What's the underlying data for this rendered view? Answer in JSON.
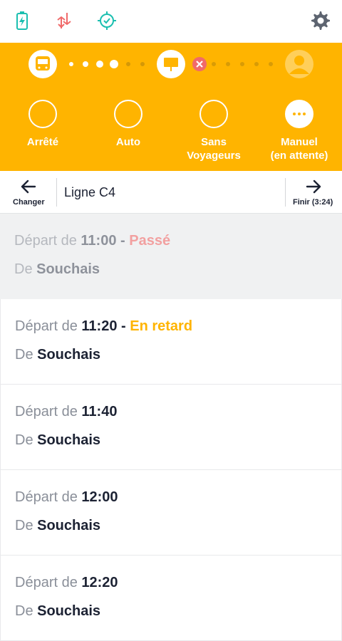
{
  "colors": {
    "accent": "#ffb400",
    "teal": "#1bbfb0",
    "red": "#f06a6a",
    "navy": "#1c2233",
    "past_status": "#f2a0a0",
    "late_status": "#ffb400"
  },
  "topbar": {
    "icons": [
      "battery-charging-icon",
      "data-transfer-icon",
      "gps-target-check-icon",
      "settings-gear-icon"
    ]
  },
  "progress": {
    "start_icon": "bus-icon",
    "middle_icon": "bus-stop-icon",
    "alert_icon": "close-x-icon",
    "end_icon": "user-avatar-icon"
  },
  "modes": [
    {
      "label": "Arrêté",
      "active": false
    },
    {
      "label": "Auto",
      "active": false
    },
    {
      "label": "Sans\nVoyageurs",
      "active": false
    },
    {
      "label": "Manuel\n(en attente)",
      "active": true
    }
  ],
  "nav": {
    "change_label": "Changer",
    "line_name": "Ligne C4",
    "finish_label": "Finir (3:24)"
  },
  "departures": [
    {
      "prefix": "Départ de ",
      "time": "11:00",
      "sep": " - ",
      "status": "Passé",
      "status_kind": "past",
      "from_prefix": "De ",
      "origin": "Souchais"
    },
    {
      "prefix": "Départ de ",
      "time": "11:20",
      "sep": " - ",
      "status": "En retard",
      "status_kind": "late",
      "from_prefix": "De ",
      "origin": "Souchais"
    },
    {
      "prefix": "Départ de ",
      "time": "11:40",
      "sep": "",
      "status": "",
      "status_kind": "",
      "from_prefix": "De ",
      "origin": "Souchais"
    },
    {
      "prefix": "Départ de ",
      "time": "12:00",
      "sep": "",
      "status": "",
      "status_kind": "",
      "from_prefix": "De ",
      "origin": "Souchais"
    },
    {
      "prefix": "Départ de ",
      "time": "12:20",
      "sep": "",
      "status": "",
      "status_kind": "",
      "from_prefix": "De ",
      "origin": "Souchais"
    }
  ]
}
